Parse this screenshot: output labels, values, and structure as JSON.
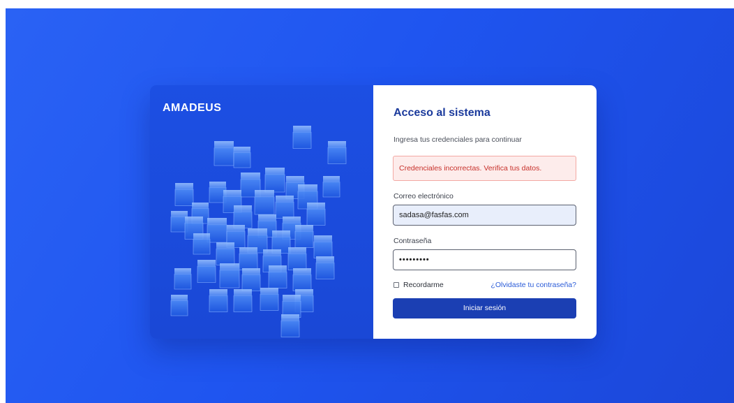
{
  "brand": {
    "logo_text": "AMADEUS"
  },
  "form": {
    "title": "Acceso al sistema",
    "subtitle": "Ingresa tus credenciales para continuar",
    "error_message": "Credenciales incorrectas. Verifica tus datos.",
    "email_label": "Correo electrónico",
    "email_value": "sadasa@fasfas.com",
    "password_label": "Contraseña",
    "password_value": "•••••••••",
    "remember_label": "Recordarme",
    "remember_checked": false,
    "forgot_link": "¿Olvidaste tu contraseña?",
    "submit_label": "Iniciar sesión"
  },
  "colors": {
    "background": "#1f55f0",
    "brand_panel": "#1c4fe3",
    "title": "#1b3a9c",
    "button": "#1b3fb3",
    "error_bg": "#fdeceb",
    "error_text": "#c7302a",
    "link": "#2a5bd8"
  }
}
